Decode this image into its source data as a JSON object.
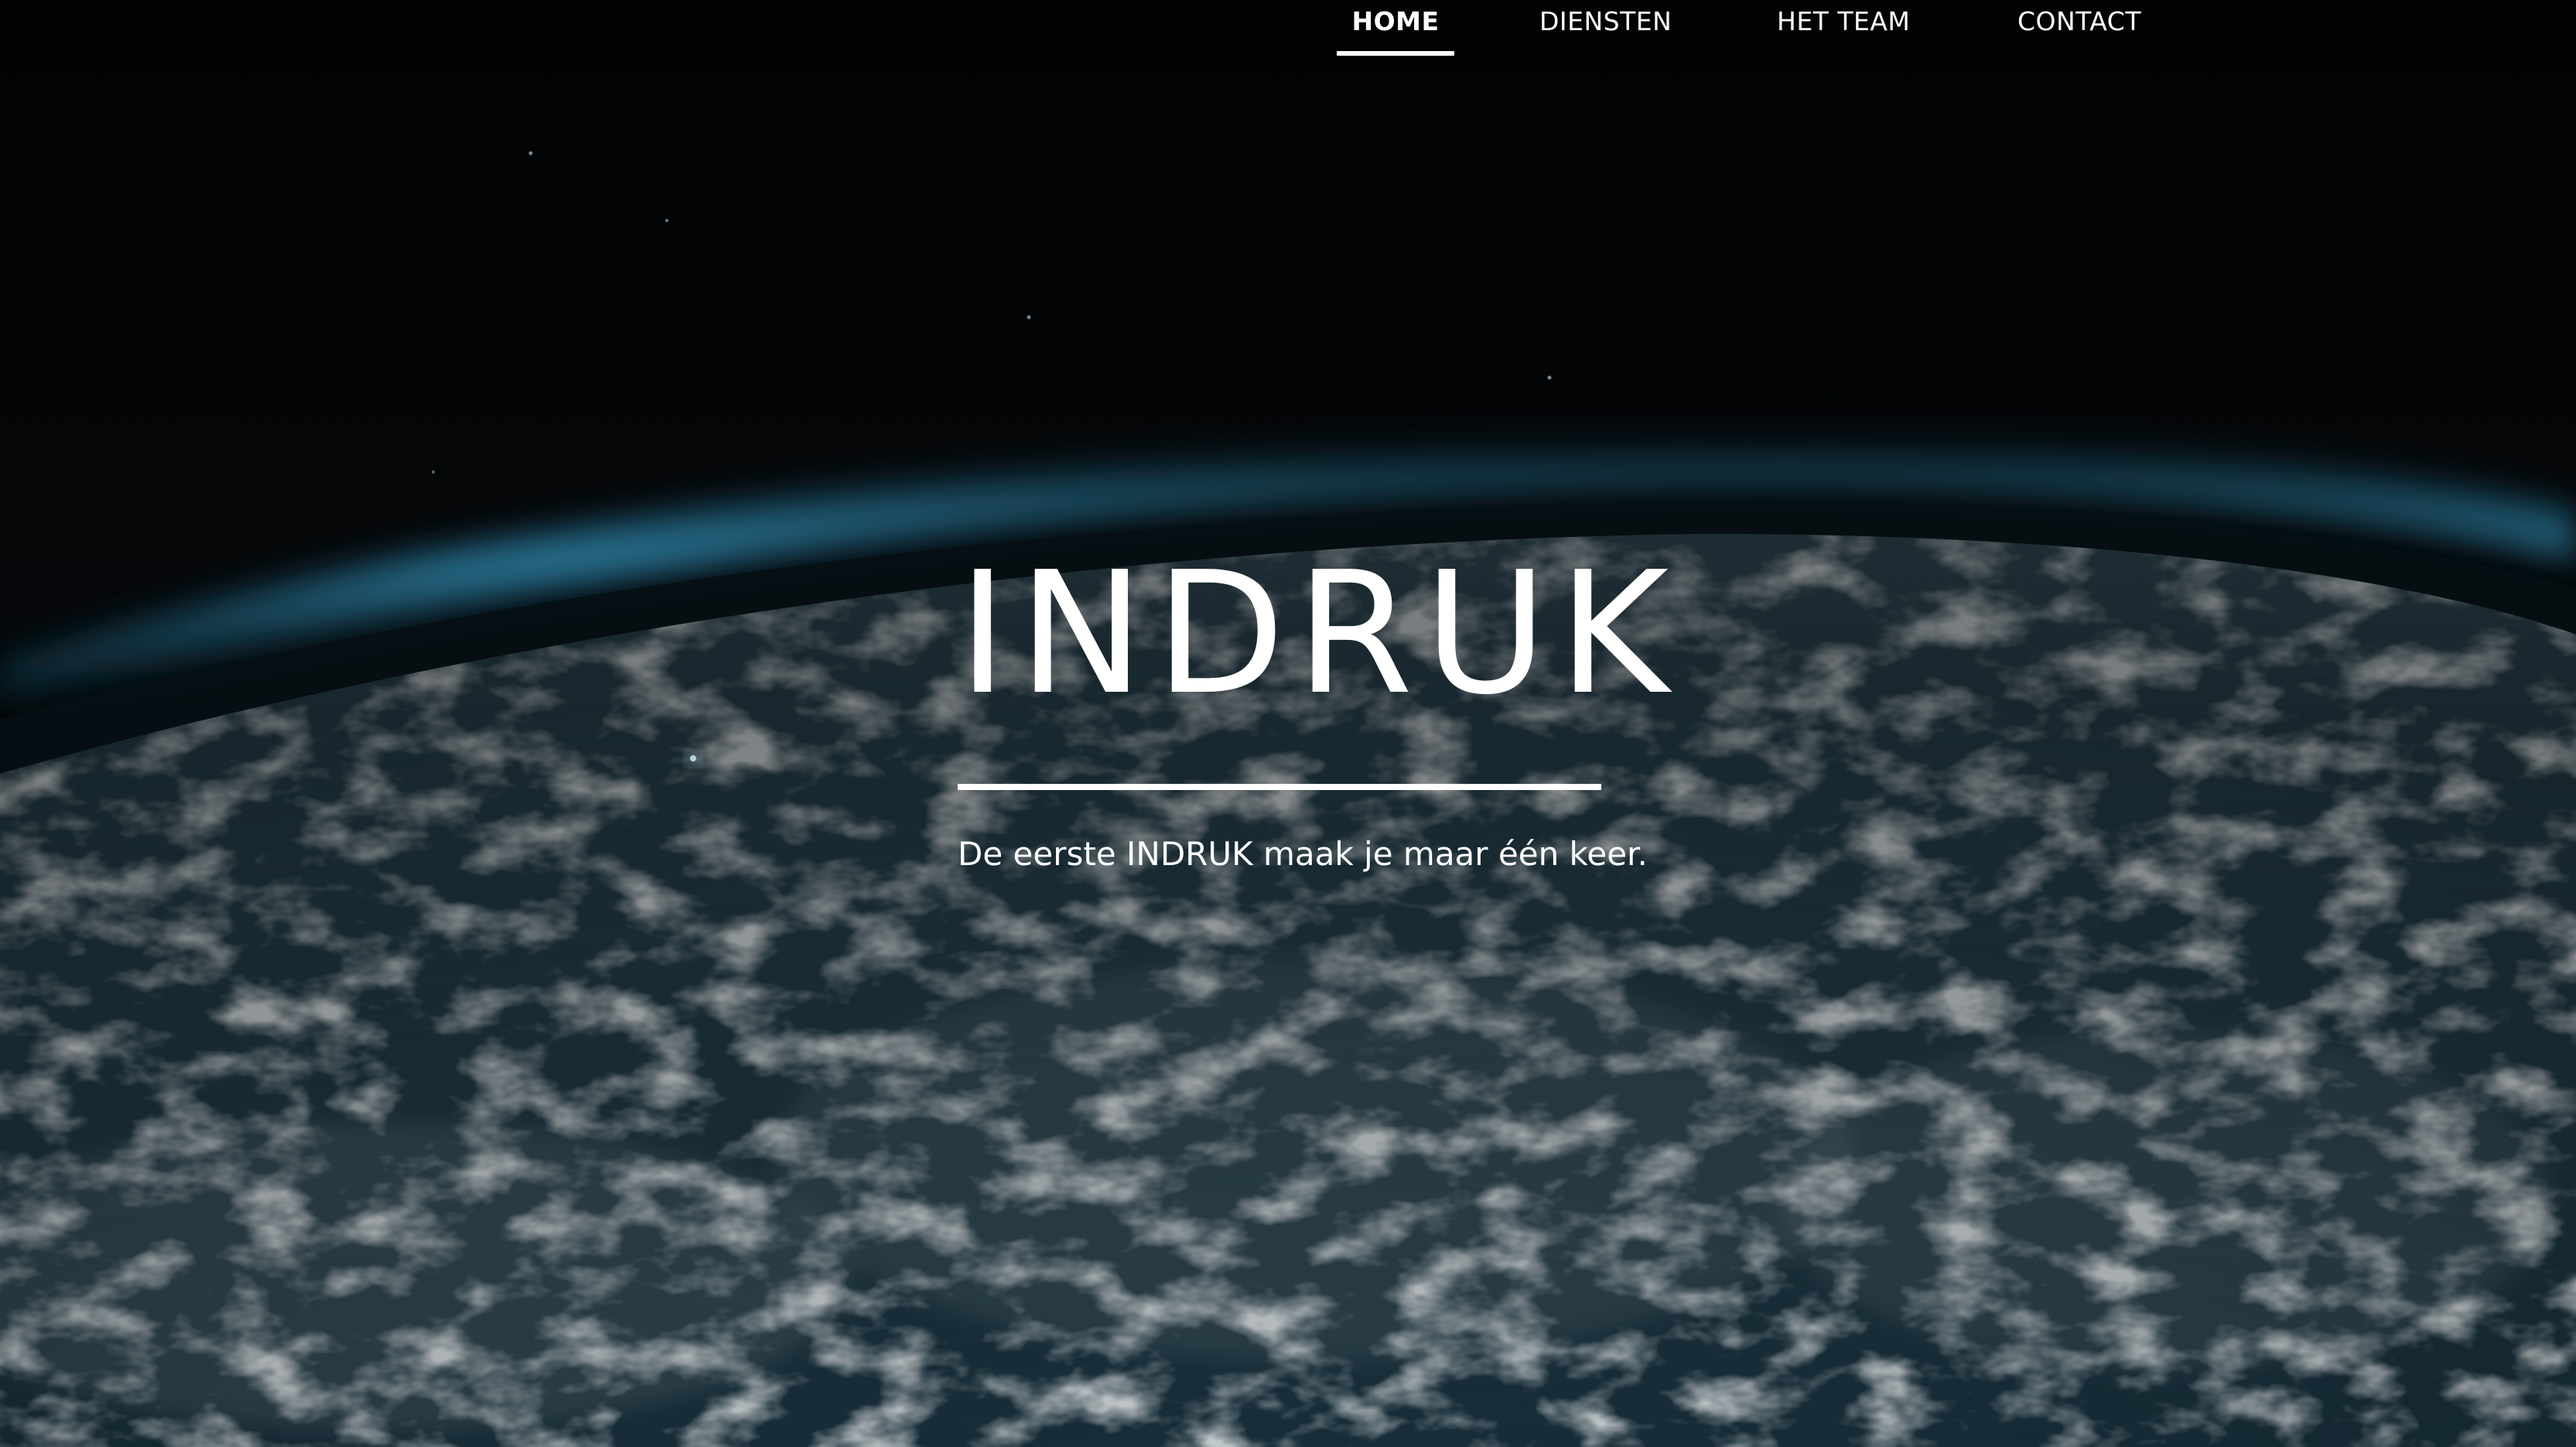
{
  "nav": {
    "items": [
      {
        "label": "HOME",
        "active": true
      },
      {
        "label": "DIENSTEN",
        "active": false
      },
      {
        "label": "HET TEAM",
        "active": false
      },
      {
        "label": "CONTACT",
        "active": false
      }
    ]
  },
  "hero": {
    "title": "INDRUK",
    "tagline": "De eerste INDRUK maak je maar één keer.",
    "background": "earth-from-space-image"
  },
  "colors": {
    "text": "#ffffff",
    "sky": "#05080b",
    "atmosphere_glow": "#2d7fa3",
    "ocean": "#1d3a48",
    "clouds": "#c9d3d6"
  }
}
